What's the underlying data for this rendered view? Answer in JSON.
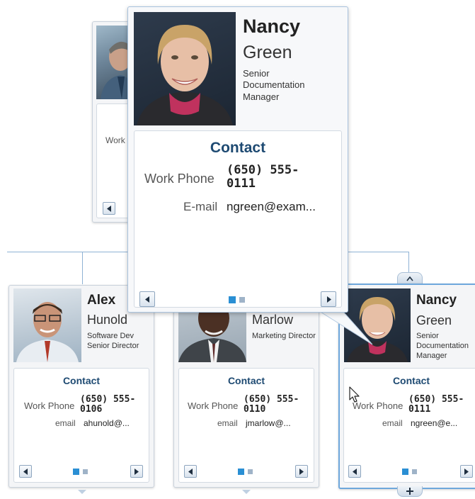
{
  "back_card": {
    "work_label": "Work"
  },
  "popup": {
    "first_name": "Nancy",
    "last_name": "Green",
    "title": "Senior Documentation Manager",
    "contact_heading": "Contact",
    "work_phone_label": "Work Phone",
    "work_phone": "(650) 555-0111",
    "email_label": "E-mail",
    "email": "ngreen@exam..."
  },
  "cards": [
    {
      "first_name": "Alex",
      "last_name": "Hunold",
      "title": "Software Dev Senior Director",
      "contact_heading": "Contact",
      "work_phone_label": "Work Phone",
      "work_phone": "(650) 555-0106",
      "email_label": "email",
      "email": "ahunold@..."
    },
    {
      "first_name": "",
      "last_name": "Marlow",
      "title": "Marketing Director",
      "contact_heading": "Contact",
      "work_phone_label": "Work Phone",
      "work_phone": "(650) 555-0110",
      "email_label": "email",
      "email": "jmarlow@..."
    },
    {
      "first_name": "Nancy",
      "last_name": "Green",
      "title": "Senior Documentation Manager",
      "contact_heading": "Contact",
      "work_phone_label": "Work Phone",
      "work_phone": "(650) 555-0111",
      "email_label": "email",
      "email": "ngreen@e..."
    }
  ],
  "icons": {
    "prev": "chevron-left-icon",
    "next": "chevron-right-icon",
    "expand": "plus-icon",
    "collapse": "chevron-up-icon",
    "cursor": "mouse-pointer-icon"
  },
  "colors": {
    "accent": "#2a8fd4",
    "heading": "#1e4a72",
    "connector": "#8fb2d4"
  }
}
